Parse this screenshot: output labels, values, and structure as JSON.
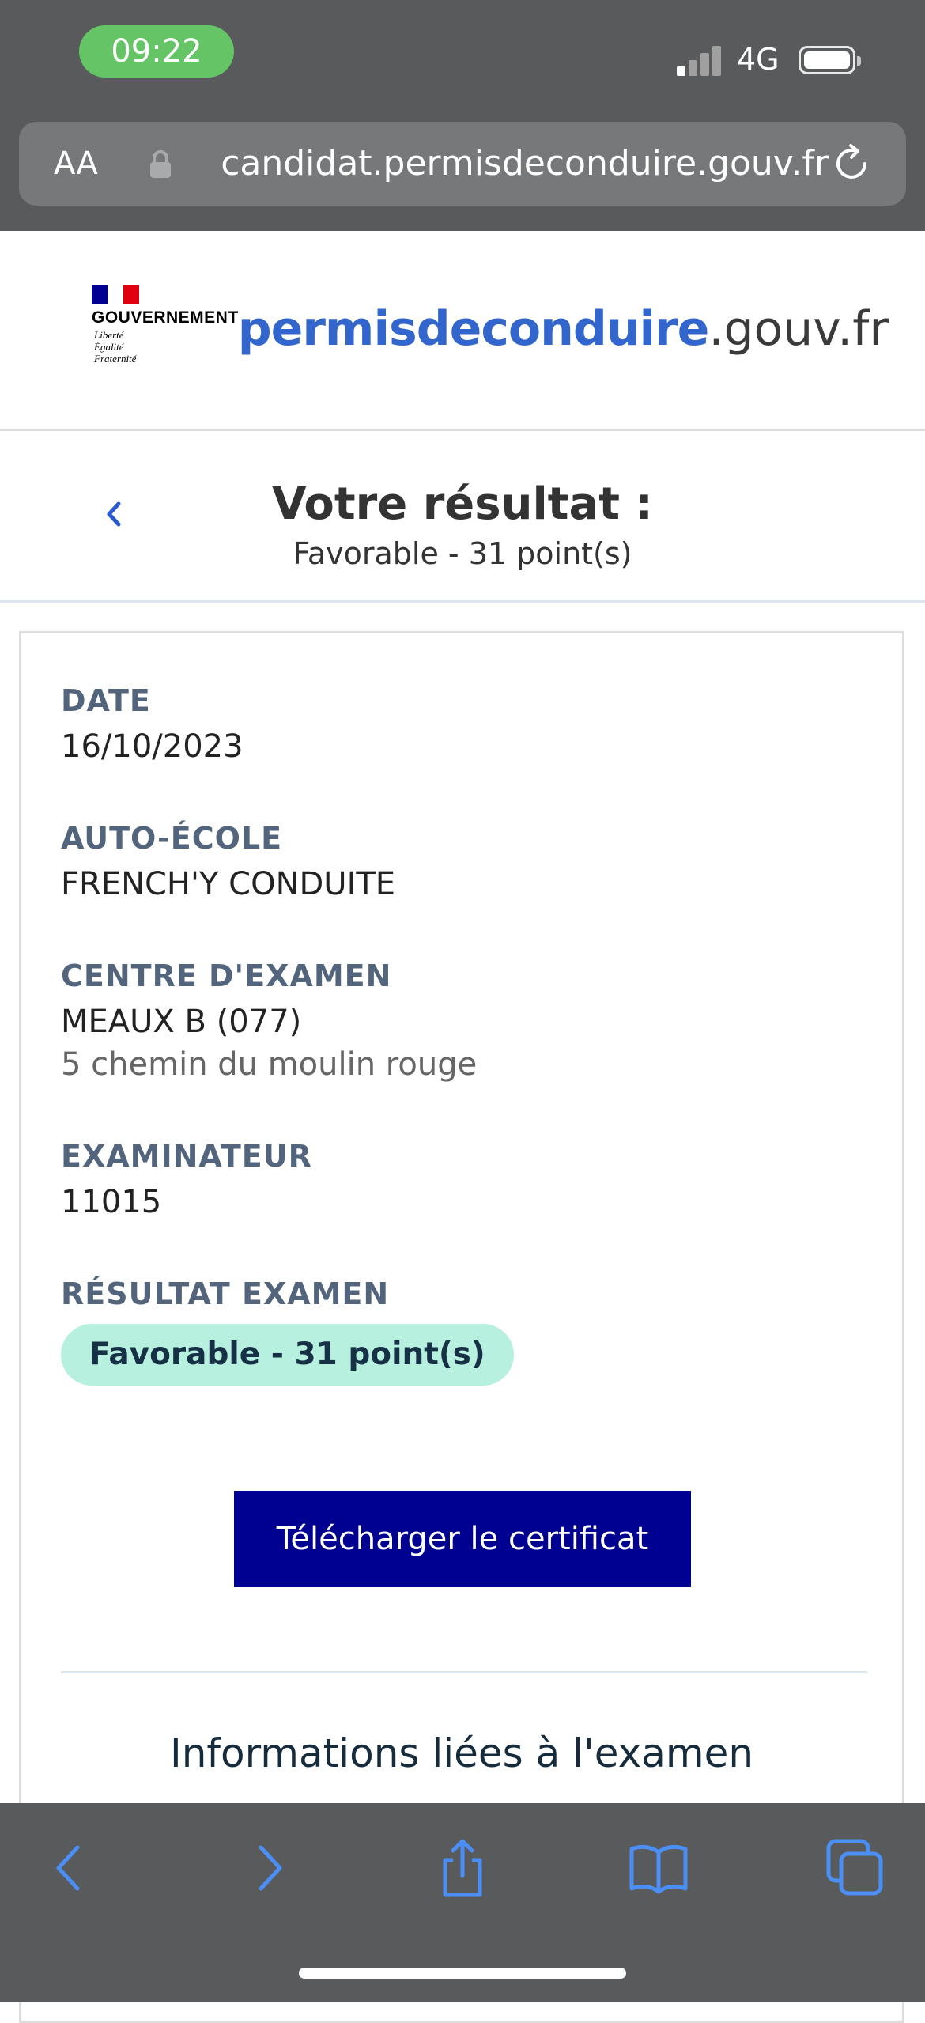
{
  "status_bar": {
    "time": "09:22",
    "network": "4G",
    "colors": {
      "time_pill": "#64c466"
    }
  },
  "browser": {
    "text_size_label": "AA",
    "url": "candidat.permisdeconduire.gouv.fr",
    "icons": [
      "lock-icon",
      "reload-icon"
    ],
    "toolbar_icons": [
      "back-icon",
      "forward-icon",
      "share-icon",
      "bookmarks-icon",
      "tabs-icon"
    ],
    "colors": {
      "toolbar_icon": "#4b8ef5"
    }
  },
  "header": {
    "gov_name": "GOUVERNEMENT",
    "gov_motto": [
      "Liberté",
      "Égalité",
      "Fraternité"
    ],
    "brand_strong": "permisdeconduire",
    "brand_domain": ".gouv.fr",
    "colors": {
      "brand": "#3366cc"
    }
  },
  "title_section": {
    "title": "Votre résultat :",
    "subtitle": "Favorable - 31 point(s)",
    "back_icon": "chevron-left-icon"
  },
  "details": {
    "date_label": "DATE",
    "date_value": "16/10/2023",
    "school_label": "AUTO-ÉCOLE",
    "school_value": "FRENCH'Y CONDUITE",
    "center_label": "CENTRE D'EXAMEN",
    "center_value": "MEAUX B (077)",
    "center_address": "5 chemin du moulin rouge",
    "examiner_label": "EXAMINATEUR",
    "examiner_value": "11015",
    "result_label": "RÉSULTAT EXAMEN",
    "result_value": "Favorable - 31 point(s)",
    "colors": {
      "label": "#53657d",
      "badge_bg": "#b8f0df",
      "button_bg": "#000091"
    }
  },
  "actions": {
    "download_label": "Télécharger le certificat"
  },
  "info_section": {
    "heading": "Informations liées à l'examen"
  }
}
